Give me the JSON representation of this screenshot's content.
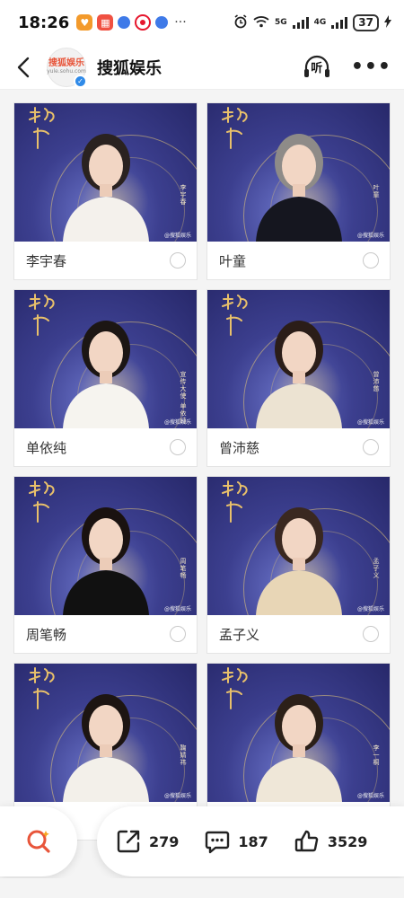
{
  "status_bar": {
    "time": "18:26",
    "network_1": "5G",
    "network_2": "4G",
    "battery": "37",
    "dots": "···"
  },
  "header": {
    "avatar_logo": "搜狐娱乐",
    "avatar_url": "yule.sohu.com",
    "title": "搜狐娱乐",
    "listen_label": "听"
  },
  "cards": [
    {
      "name": "李宇春",
      "poster_name": "李宇春",
      "watermark": "@搜狐娱乐"
    },
    {
      "name": "叶童",
      "poster_name": "叶童",
      "watermark": "@搜狐娱乐"
    },
    {
      "name": "单依纯",
      "poster_name": "宣传大使 单依纯",
      "watermark": "@搜狐娱乐"
    },
    {
      "name": "曾沛慈",
      "poster_name": "曾沛慈",
      "watermark": "@搜狐娱乐"
    },
    {
      "name": "周笔畅",
      "poster_name": "周笔畅",
      "watermark": "@搜狐娱乐"
    },
    {
      "name": "孟子义",
      "poster_name": "孟子义",
      "watermark": "@搜狐娱乐"
    },
    {
      "name": "",
      "poster_name": "鞠婧祎",
      "watermark": "@搜狐娱乐"
    },
    {
      "name": "",
      "poster_name": "李一桐",
      "watermark": "@搜狐娱乐"
    }
  ],
  "bottom_bar": {
    "share_count": "279",
    "comment_count": "187",
    "like_count": "3529"
  },
  "colors": {
    "accent": "#e8553a",
    "poster_bg": "#3c3f8f",
    "gold": "#e6c878"
  }
}
